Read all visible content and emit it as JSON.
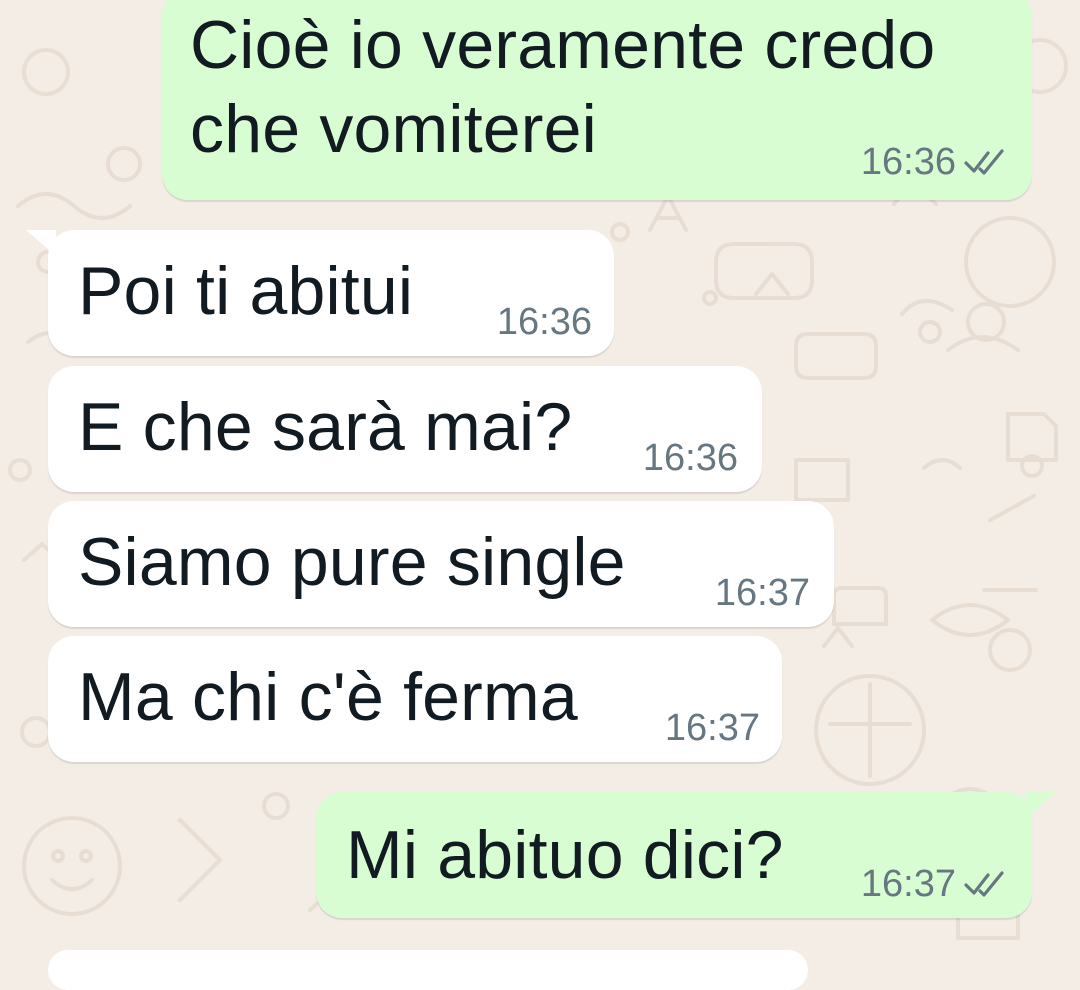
{
  "chat": {
    "messages": [
      {
        "direction": "outgoing",
        "lines": [
          "Cioè io veramente credo",
          "che vomiterei"
        ],
        "time": "16:36",
        "status_icon": "double-check-icon"
      },
      {
        "direction": "incoming",
        "text": "Poi ti abitui",
        "time": "16:36"
      },
      {
        "direction": "incoming",
        "text": "E che sarà mai?",
        "time": "16:36"
      },
      {
        "direction": "incoming",
        "text": "Siamo pure single",
        "time": "16:37"
      },
      {
        "direction": "incoming",
        "text": "Ma chi c'è ferma",
        "time": "16:37"
      },
      {
        "direction": "outgoing",
        "text": "Mi abituo dici?",
        "time": "16:37",
        "status_icon": "double-check-icon"
      }
    ]
  },
  "colors": {
    "wallpaper": "#f3ede6",
    "incoming_bubble": "#ffffff",
    "outgoing_bubble": "#d9fdd3",
    "message_text": "#111b21",
    "timestamp": "#667781"
  }
}
